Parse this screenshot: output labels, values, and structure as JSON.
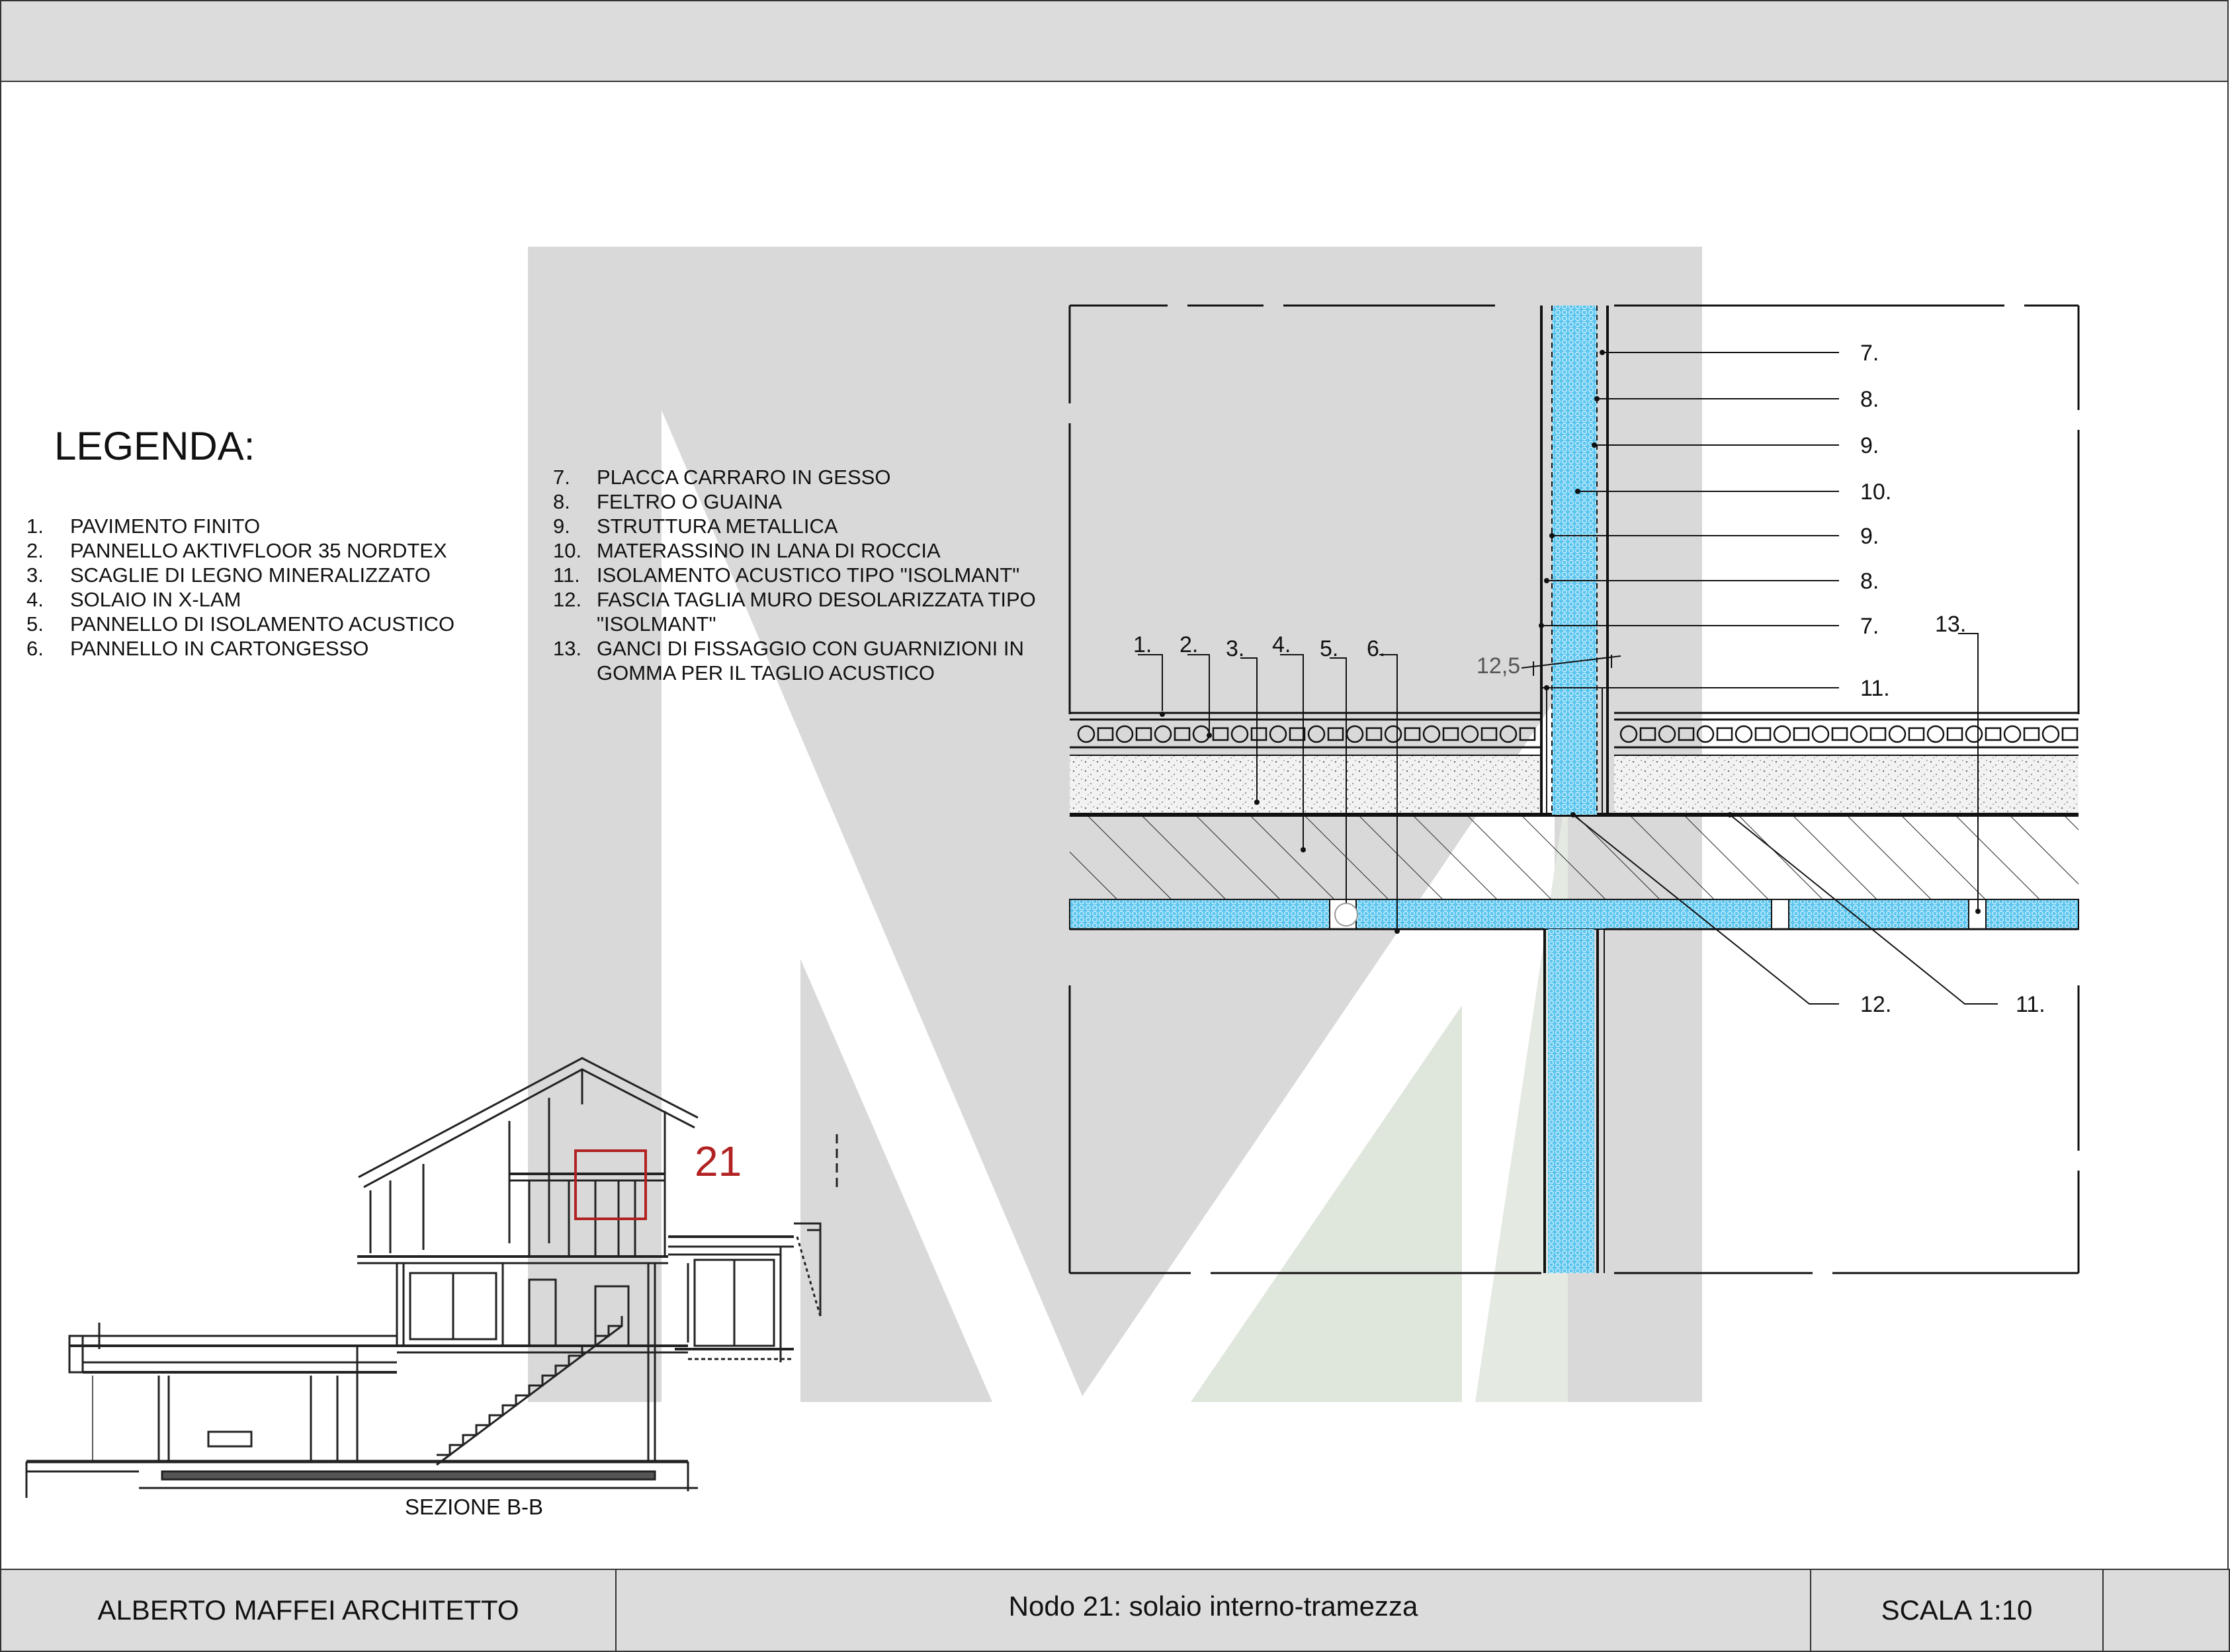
{
  "header": {
    "logo_letter": "M"
  },
  "legend": {
    "title": "LEGENDA:",
    "items_left": [
      {
        "num": "1.",
        "text": "PAVIMENTO FINITO"
      },
      {
        "num": "2.",
        "text": "PANNELLO AKTIVFLOOR 35  NORDTEX"
      },
      {
        "num": "3.",
        "text": "SCAGLIE DI LEGNO MINERALIZZATO"
      },
      {
        "num": "4.",
        "text": "SOLAIO IN X-LAM"
      },
      {
        "num": "5.",
        "text": "PANNELLO DI ISOLAMENTO ACUSTICO"
      },
      {
        "num": "6.",
        "text": "PANNELLO IN CARTONGESSO"
      }
    ],
    "items_right": [
      {
        "num": "7.",
        "text": "PLACCA CARRARO IN GESSO"
      },
      {
        "num": "8.",
        "text": "FELTRO O GUAINA"
      },
      {
        "num": "9.",
        "text": "STRUTTURA METALLICA"
      },
      {
        "num": "10.",
        "text": "MATERASSINO IN LANA DI ROCCIA"
      },
      {
        "num": "11.",
        "text": "ISOLAMENTO ACUSTICO TIPO \"ISOLMANT\""
      },
      {
        "num": "12.",
        "text": "FASCIA TAGLIA MURO DESOLARIZZATA TIPO"
      },
      {
        "num": "",
        "text": "\"ISOLMANT\""
      },
      {
        "num": "13.",
        "text": "GANCI DI FISSAGGIO CON GUARNIZIONI IN"
      },
      {
        "num": "",
        "text": "GOMMA PER IL TAGLIO ACUSTICO"
      }
    ]
  },
  "detail": {
    "top_labels": [
      "1.",
      "2.",
      "3.",
      "4.",
      "5.",
      "6."
    ],
    "right_labels": [
      "7.",
      "8.",
      "9.",
      "10.",
      "9.",
      "8.",
      "7.",
      "11."
    ],
    "label_13": "13.",
    "bottom_labels": [
      "12.",
      "11."
    ],
    "dimension": "12,5"
  },
  "section": {
    "node_number": "21",
    "caption": "SEZIONE B-B"
  },
  "footer": {
    "author": "ALBERTO MAFFEI ARCHITETTO",
    "title": "Nodo 21: solaio interno-tramezza",
    "scale": "SCALA 1:10"
  },
  "colors": {
    "insulation_blue": "#5cc6ef",
    "watermark_gray": "#d9d9d9",
    "watermark_green": "#dfe6dc",
    "node_red": "#b22222",
    "header_gray": "#dcdcdc"
  }
}
